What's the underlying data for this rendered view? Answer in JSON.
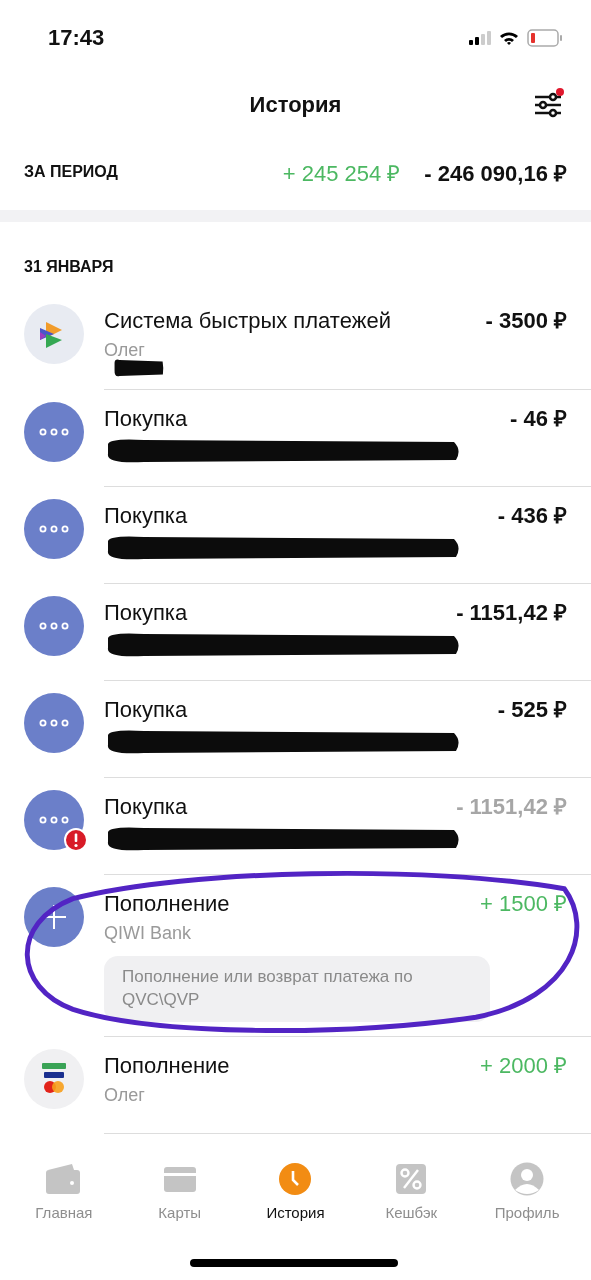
{
  "status_bar": {
    "time": "17:43"
  },
  "header": {
    "title": "История",
    "filter_badge": true
  },
  "period": {
    "label": "ЗА ПЕРИОД",
    "income": "+ 245 254 ₽",
    "expense": "- 246 090,16 ₽"
  },
  "date": "31 ЯНВАРЯ",
  "transactions": [
    {
      "kind": "sbp",
      "title": "Система быстрых платежей",
      "subtitle": "Олег",
      "amount": "- 3500 ₽",
      "incoming": false,
      "failed": false,
      "redacted": true,
      "annotated": false
    },
    {
      "kind": "purchase",
      "title": "Покупка",
      "amount": "- 46 ₽",
      "incoming": false,
      "failed": false,
      "redacted": true,
      "annotated": false
    },
    {
      "kind": "purchase",
      "title": "Покупка",
      "amount": "- 436 ₽",
      "incoming": false,
      "failed": false,
      "redacted": true,
      "annotated": false
    },
    {
      "kind": "purchase",
      "title": "Покупка",
      "amount": "- 1151,42 ₽",
      "incoming": false,
      "failed": false,
      "redacted": true,
      "annotated": false
    },
    {
      "kind": "purchase",
      "title": "Покупка",
      "amount": "- 525 ₽",
      "incoming": false,
      "failed": false,
      "redacted": true,
      "annotated": false
    },
    {
      "kind": "purchase",
      "title": "Покупка",
      "amount": "- 1151,42 ₽",
      "incoming": false,
      "failed": true,
      "redacted": true,
      "annotated": false
    },
    {
      "kind": "topup",
      "title": "Пополнение",
      "subtitle": "QIWI Bank",
      "note": "Пополнение или возврат платежа по QVC\\QVP",
      "amount": "+ 1500 ₽",
      "incoming": true,
      "failed": false,
      "redacted": false,
      "annotated": true
    },
    {
      "kind": "card",
      "title": "Пополнение",
      "subtitle": "Олег",
      "amount": "+ 2000 ₽",
      "incoming": true,
      "failed": false,
      "redacted": false,
      "annotated": false
    }
  ],
  "tabs": [
    {
      "kind": "wallet",
      "label": "Главная",
      "selected": false
    },
    {
      "kind": "card",
      "label": "Карты",
      "selected": false
    },
    {
      "kind": "clock",
      "label": "История",
      "selected": true
    },
    {
      "kind": "percent",
      "label": "Кешбэк",
      "selected": false
    },
    {
      "kind": "person",
      "label": "Профиль",
      "selected": false
    }
  ]
}
